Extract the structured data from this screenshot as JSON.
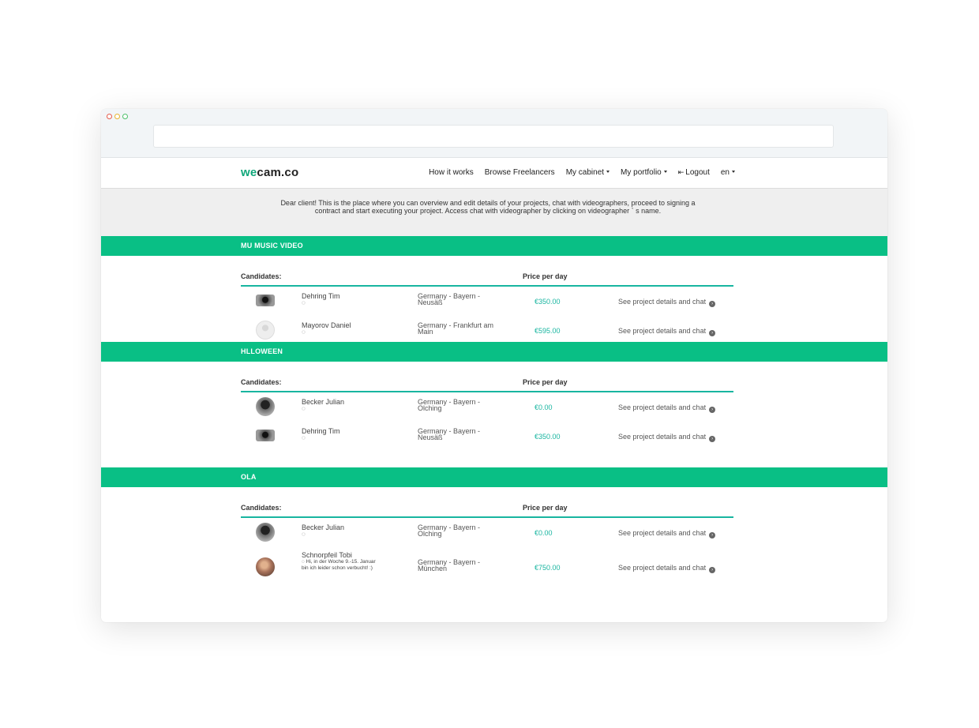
{
  "brand": {
    "prefix": "we",
    "suffix": "cam.co"
  },
  "nav": {
    "how_it_works": "How it works",
    "browse": "Browse Freelancers",
    "cabinet": "My cabinet",
    "portfolio": "My portfolio",
    "logout": "Logout",
    "lang": "en"
  },
  "intro": "Dear client! This is the place where you can overview and edit details of your projects, chat with videographers, proceed to signing a contract and start executing your project. Access chat with videographer by clicking on videographer ` s name.",
  "table_headers": {
    "candidates": "Candidates:",
    "price": "Price per day"
  },
  "projects": [
    {
      "title": "MU MUSIC VIDEO",
      "rows": [
        {
          "name": "Dehring Tim",
          "location": "Germany - Bayern - Neusäß",
          "price": "€350.00",
          "action": "See project details and chat",
          "message": ""
        },
        {
          "name": "Mayorov Daniel",
          "location": "Germany - Frankfurt am Main",
          "price": "€595.00",
          "action": "See project details and chat",
          "message": ""
        }
      ]
    },
    {
      "title": "HLLOWEEN",
      "rows": [
        {
          "name": "Becker Julian",
          "location": "Germany - Bayern - Olching",
          "price": "€0.00",
          "action": "See project details and chat",
          "message": ""
        },
        {
          "name": "Dehring Tim",
          "location": "Germany - Bayern - Neusäß",
          "price": "€350.00",
          "action": "See project details and chat",
          "message": ""
        }
      ]
    },
    {
      "title": "OLA",
      "rows": [
        {
          "name": "Becker Julian",
          "location": "Germany - Bayern - Olching",
          "price": "€0.00",
          "action": "See project details and chat",
          "message": ""
        },
        {
          "name": "Schnorpfeil Tobi",
          "location": "Germany - Bayern - München",
          "price": "€750.00",
          "action": "See project details and chat",
          "message": "Hi, in der Woche 9.-15. Januar bin ich leider schon verbucht! :)"
        }
      ]
    }
  ]
}
